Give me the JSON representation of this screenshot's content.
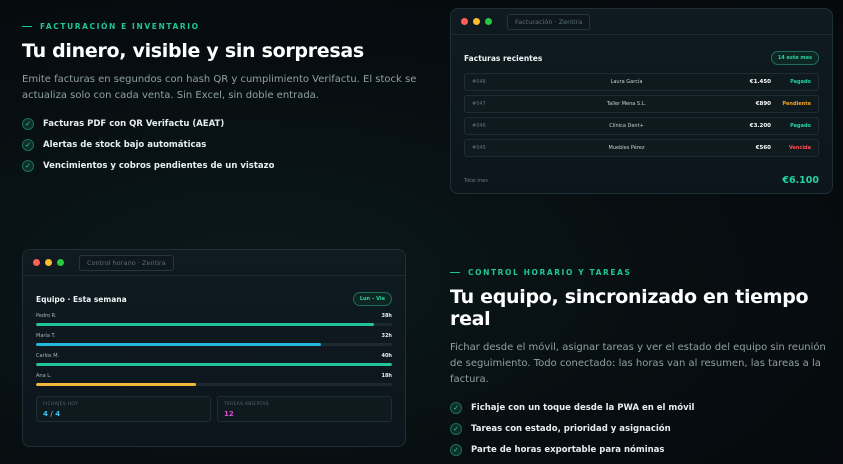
{
  "section1": {
    "eyebrow": "FACTURACIÓN E INVENTARIO",
    "headline": "Tu dinero, visible y sin sorpresas",
    "description": "Emite facturas en segundos con hash QR y cumplimiento Verifactu. El stock se actualiza solo con cada venta. Sin Excel, sin doble entrada.",
    "features": [
      "Facturas PDF con QR Verifactu (AEAT)",
      "Alertas de stock bajo automáticas",
      "Vencimientos y cobros pendientes de un vistazo"
    ]
  },
  "invoice_window": {
    "url": "Facturación · Zentira",
    "title": "Facturas recientes",
    "pill": "14 este mes",
    "rows": [
      {
        "num": "#048",
        "client": "Laura García",
        "amount": "€1.450",
        "status": "Pagado"
      },
      {
        "num": "#047",
        "client": "Taller Mena S.L.",
        "amount": "€890",
        "status": "Pendiente"
      },
      {
        "num": "#046",
        "client": "Clínica Dent+",
        "amount": "€3.200",
        "status": "Pagado"
      },
      {
        "num": "#045",
        "client": "Muebles Pérez",
        "amount": "€560",
        "status": "Vencida"
      }
    ],
    "total_label": "Total mes",
    "total_value": "€6.100"
  },
  "team_window": {
    "url": "Control horario · Zentira",
    "title": "Equipo · Esta semana",
    "pill": "Lun – Vie",
    "members": [
      {
        "name": "Pedro R.",
        "hours": "38h",
        "progress": 0.95
      },
      {
        "name": "María T.",
        "hours": "32h",
        "progress": 0.8
      },
      {
        "name": "Carlos M.",
        "hours": "40h",
        "progress": 1.0
      },
      {
        "name": "Ana L.",
        "hours": "18h",
        "progress": 0.45
      }
    ],
    "stats": [
      {
        "label": "FICHAJES HOY",
        "value": "4 / 4"
      },
      {
        "label": "TAREAS ABIERTAS",
        "value": "12"
      }
    ]
  },
  "section2": {
    "eyebrow": "CONTROL HORARIO Y TAREAS",
    "headline": "Tu equipo, sincronizado en tiempo real",
    "description": "Fichar desde el móvil, asignar tareas y ver el estado del equipo sin reunión de seguimiento. Todo conectado: las horas van al resumen, las tareas a la factura.",
    "features": [
      "Fichaje con un toque desde la PWA en el móvil",
      "Tareas con estado, prioridad y asignación",
      "Parte de horas exportable para nóminas"
    ]
  },
  "colors": {
    "accent": "#1fc49a",
    "paid": "#26d3a4",
    "pending": "#f5a524",
    "overdue": "#ff4d4f",
    "bar_green": "#1fc49a",
    "bar_blue": "#23b8e0",
    "bar_yellow": "#f5b73b",
    "stat_blue": "#3fc6ee",
    "stat_pink": "#d94fd0"
  }
}
